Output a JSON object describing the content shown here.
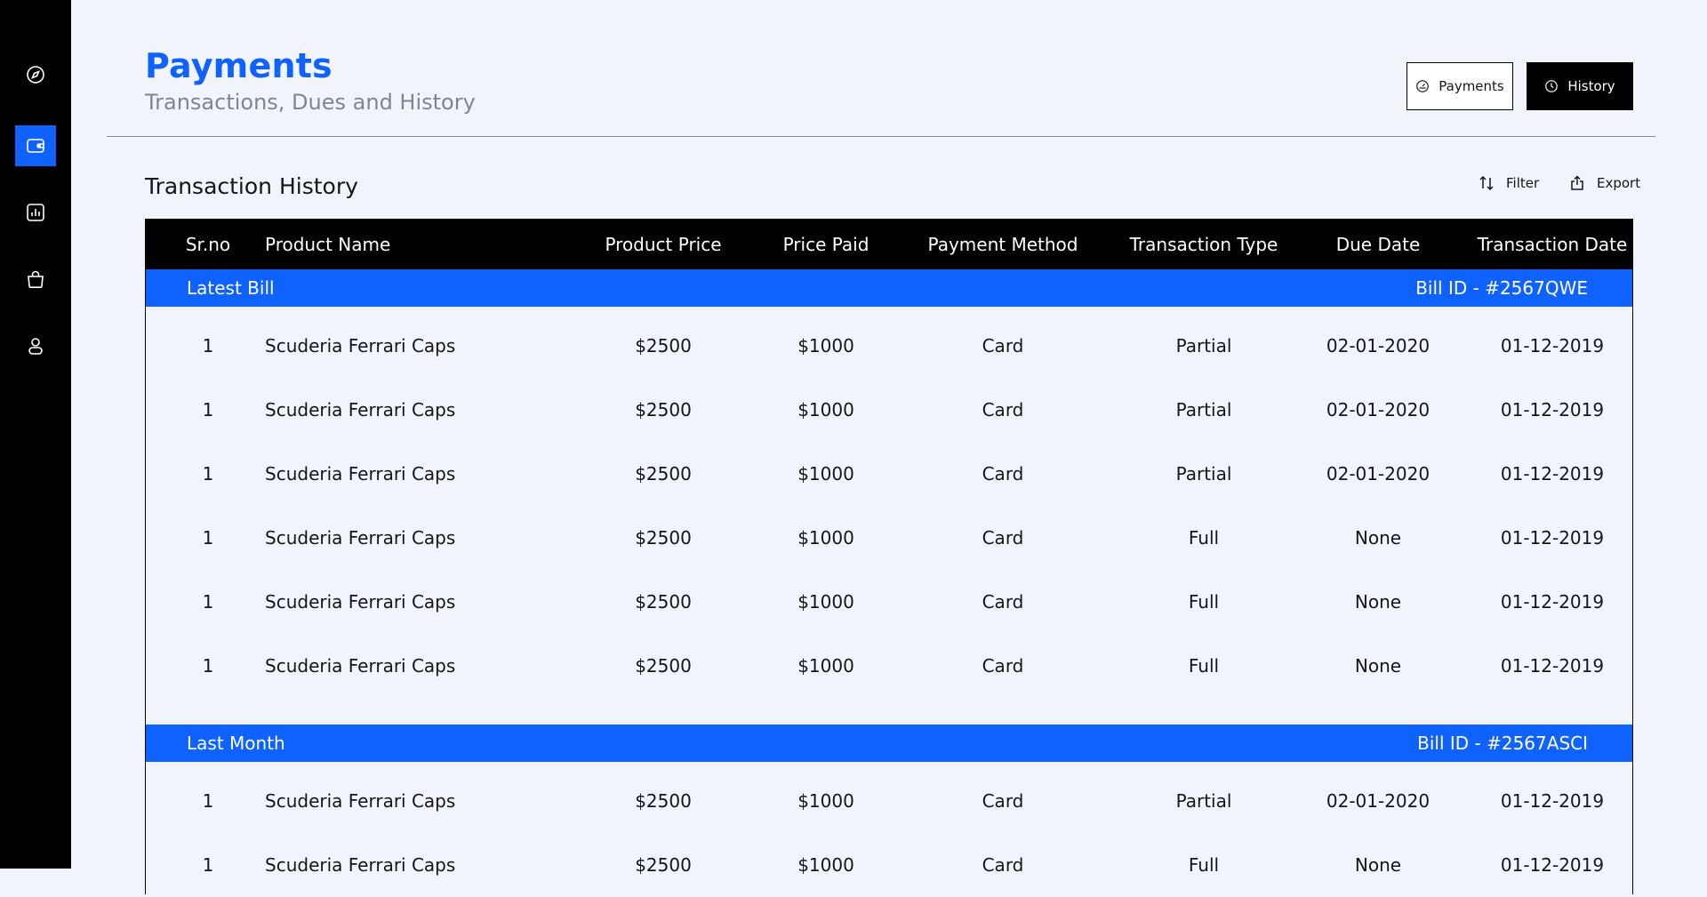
{
  "header": {
    "title": "Payments",
    "subtitle": "Transactions, Dues and History",
    "payments_btn": "Payments",
    "history_btn": "History"
  },
  "sidebar": {
    "items": [
      {
        "icon": "compass-icon",
        "active": false
      },
      {
        "icon": "wallet-icon",
        "active": true
      },
      {
        "icon": "chart-icon",
        "active": false
      },
      {
        "icon": "shopping-bag-icon",
        "active": false
      },
      {
        "icon": "user-icon",
        "active": false
      }
    ]
  },
  "section": {
    "title": "Transaction History",
    "filter": "Filter",
    "export": "Export"
  },
  "table": {
    "columns": [
      "Sr.no",
      "Product Name",
      "Product Price",
      "Price Paid",
      "Payment Method",
      "Transaction Type",
      "Due Date",
      "Transaction Date"
    ],
    "groups": [
      {
        "label": "Latest Bill",
        "bill": "Bill ID - #2567QWE",
        "rows": [
          [
            "1",
            "Scuderia Ferrari Caps",
            "$2500",
            "$1000",
            "Card",
            "Partial",
            "02-01-2020",
            "01-12-2019"
          ],
          [
            "1",
            "Scuderia Ferrari Caps",
            "$2500",
            "$1000",
            "Card",
            "Partial",
            "02-01-2020",
            "01-12-2019"
          ],
          [
            "1",
            "Scuderia Ferrari Caps",
            "$2500",
            "$1000",
            "Card",
            "Partial",
            "02-01-2020",
            "01-12-2019"
          ],
          [
            "1",
            "Scuderia Ferrari Caps",
            "$2500",
            "$1000",
            "Card",
            "Full",
            "None",
            "01-12-2019"
          ],
          [
            "1",
            "Scuderia Ferrari Caps",
            "$2500",
            "$1000",
            "Card",
            "Full",
            "None",
            "01-12-2019"
          ],
          [
            "1",
            "Scuderia Ferrari Caps",
            "$2500",
            "$1000",
            "Card",
            "Full",
            "None",
            "01-12-2019"
          ]
        ]
      },
      {
        "label": "Last Month",
        "bill": "Bill ID - #2567ASCI",
        "rows": [
          [
            "1",
            "Scuderia Ferrari Caps",
            "$2500",
            "$1000",
            "Card",
            "Partial",
            "02-01-2020",
            "01-12-2019"
          ],
          [
            "1",
            "Scuderia Ferrari Caps",
            "$2500",
            "$1000",
            "Card",
            "Full",
            "None",
            "01-12-2019"
          ]
        ]
      }
    ]
  },
  "colors": {
    "accent": "#0f62fe",
    "background": "#f2f4fc",
    "sidebar": "#000000",
    "subtitle": "#808591"
  }
}
